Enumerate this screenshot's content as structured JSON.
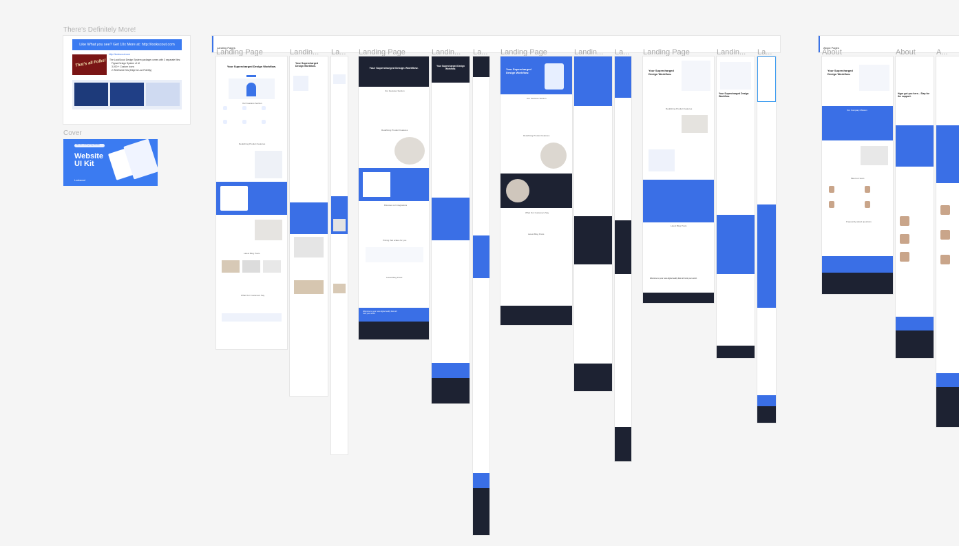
{
  "canvas": {
    "background": "#f5f5f5",
    "accent": "#3a73e8",
    "dark": "#1d2232"
  },
  "left_panel": {
    "extra_label": "There's Definitely More!",
    "promo_banner": "Like What you see? Get 10x More at: http://lookscout.com",
    "promo_link": "http://lookscout.com",
    "promo_body": "The LookScout Design System package comes with 3 separate files:",
    "promo_items": [
      "Figma Design System of UI",
      "3,000 + Custom Icons",
      "2 Wireframe Kits (Edge & Low Fidelity)"
    ],
    "promo_image_text": "That's all Folks!",
    "cover_label": "Cover",
    "cover_title": "Website UI Kit",
    "cover_badge": "Ultimate Landing Page Builder",
    "cover_brand": "Lookscout"
  },
  "landing_header": {
    "page_name": "Landing Pages",
    "labels": [
      "Landing Page",
      "Landin...",
      "La...",
      "Landing Page",
      "Landin...",
      "La...",
      "Landing Page",
      "Landin...",
      "La...",
      "Landing Page",
      "Landin...",
      "La..."
    ]
  },
  "about_header": {
    "page_name": "About Pages",
    "labels": [
      "About",
      "About",
      "A..."
    ]
  },
  "frame_content": {
    "hero_title": "Your Supercharged Design Workflow.",
    "hero_title_alt": "Your Supercharged Design Workflow.",
    "features_title": "Our Features Section",
    "workflow_title": "Redefining Product Features",
    "blog_title": "Latest Blog Posts",
    "testimonials_title": "What Our Customers Say",
    "pricing_title": "Pricing that scales for you",
    "integrations_title": "Discover our integrations",
    "cta_title": "Welcome to your new digital reality that will rock your world.",
    "company_title": "Our Company Mission",
    "team_title": "Meet our team",
    "faq_title": "Frequently asked questions",
    "about_hero": "Hype got you here... Stay for the support."
  }
}
